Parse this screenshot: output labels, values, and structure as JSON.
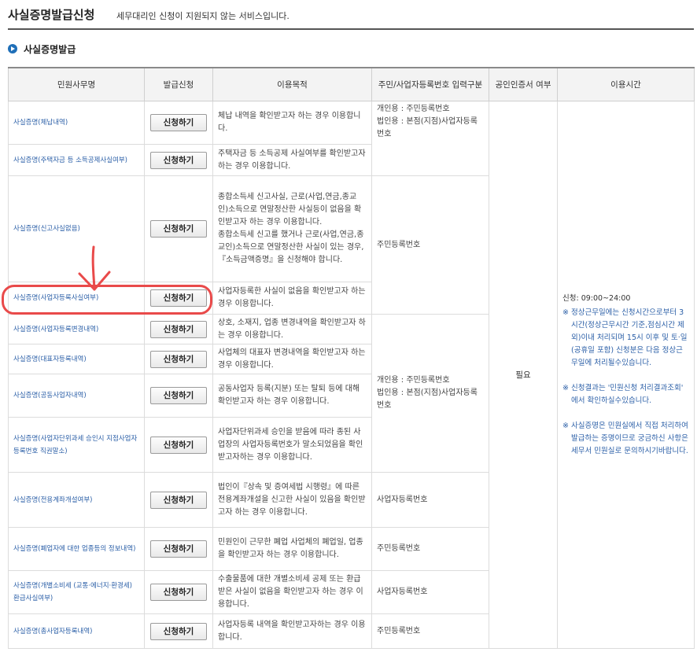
{
  "header": {
    "title": "사실증명발급신청",
    "subtitle": "세무대리인 신청이 지원되지 않는 서비스입니다."
  },
  "section": {
    "title": "사실증명발급"
  },
  "table": {
    "columns": [
      "민원사무명",
      "발급신청",
      "이용목적",
      "주민/사업자등록번호 입력구분",
      "공인인증서 여부",
      "이용시간"
    ],
    "apply_label": "신청하기",
    "rows": [
      {
        "name": "사실증명(체납내역)",
        "purpose": "체납 내역을 확인받고자 하는 경우 이용합니다."
      },
      {
        "name": "사실증명(주택자금 등 소득공제사실여부)",
        "purpose": "주택자금 등 소득공제 사실여부를 확인받고자 하는 경우 이용합니다."
      },
      {
        "name": "사실증명(신고사실없음)",
        "purpose": "종합소득세 신고사실, 근로(사업,연금,종교인)소득으로 연말정산한 사실등이 없음을 확인받고자 하는 경우 이용합니다.",
        "purpose2": "종합소득세 신고를 했거나 근로(사업,연금,종교인)소득으로 연말정산한 사실이 있는 경우, 『소득금액증명』을 신청해야 합니다."
      },
      {
        "name": "사실증명(사업자등록사실여부)",
        "purpose": "사업자등록한 사실이 없음을 확인받고자 하는 경우 이용합니다."
      },
      {
        "name": "사실증명(사업자등록변경내역)",
        "purpose": "상호, 소재지, 업종 변경내역을 확인받고자 하는 경우 이용합니다."
      },
      {
        "name": "사실증명(대표자등록내역)",
        "purpose": "사업체의 대표자 변경내역을 확인받고자 하는 경우 이용합니다."
      },
      {
        "name": "사실증명(공동사업자내역)",
        "purpose": "공동사업자 등록(지분) 또는 탈퇴 등에 대해 확인받고자 하는 경우 이용합니다."
      },
      {
        "name": "사실증명(사업자단위과세 승인시 지점사업자등록번호 직권말소)",
        "purpose": "사업자단위과세 승인을 받음에 따라 종된 사업장의 사업자등록번호가 말소되었음을 확인받고자하는 경우 이용합니다."
      },
      {
        "name": "사실증명(전용계좌개설여부)",
        "purpose": "법인이『상속 및 증여세법 시행령』에 따른 전용계좌개설을 신고한 사실이 있음을 확인받고자 하는 경우 이용합니다."
      },
      {
        "name": "사실증명(폐업자에 대한 업종등의 정보내역)",
        "purpose": "민원인이 근무한 폐업 사업체의 폐업일, 업종을 확인받고자 하는 경우 이용합니다."
      },
      {
        "name": "사실증명(개별소비세 (교통·에너지·환경세) 환급사실여부)",
        "purpose": "수출물품에 대한 개별소비세 공제 또는 환급받은 사실이 없음을 확인받고자 하는 경우 이용합니다."
      },
      {
        "name": "사실증명(총사업자등록내역)",
        "purpose": "사업자등록 내역을 확인받고자하는 경우 이용합니다."
      }
    ],
    "id_groups": [
      "개인용 : 주민등록번호\n법인용 : 본점(지점)사업자등록번호",
      "주민등록번호",
      "개인용 : 주민등록번호\n법인용 : 본점(지점)사업자등록번호",
      "사업자등록번호",
      "주민등록번호",
      "사업자등록번호",
      "주민등록번호"
    ],
    "cert": "필요",
    "hours": {
      "time": "신청: 09:00~24:00",
      "note1": "※ 정상근무일에는 신청시간으로부터 3시간(정상근무시간 기준,점심시간 제외)이내 처리되며 15시 이후 및 토·일(공휴일 포함) 신청분은 다음 정상근무일에 처리될수있습니다.",
      "note2": "※ 신청결과는 '민원신청 처리결과조회' 에서 확인하실수있습니다.",
      "note3": "※ 사실증명은 민원실에서 직접 처리하여 발급하는 증명이므로 궁금하신 사항은 세무서 민원실로 문의하시기바랍니다."
    }
  }
}
